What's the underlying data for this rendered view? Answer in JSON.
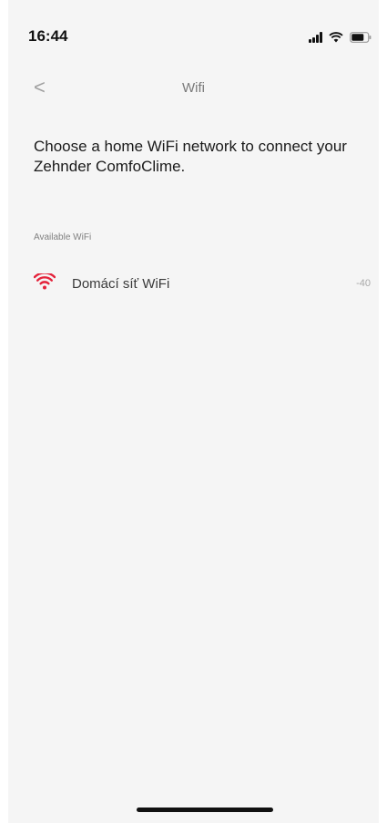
{
  "status_bar": {
    "time": "16:44"
  },
  "nav": {
    "back_icon": "chevron-left-icon",
    "back_glyph": "<",
    "title": "Wifi"
  },
  "instruction": "Choose a home WiFi network to connect your Zehnder ComfoClime.",
  "section_header": "Available WiFi",
  "networks": [
    {
      "name": "Domácí síť WiFi",
      "signal": "-40",
      "icon": "wifi-icon",
      "icon_color": "#e4233b"
    }
  ],
  "colors": {
    "background": "#f5f5f5",
    "accent": "#e4233b"
  }
}
